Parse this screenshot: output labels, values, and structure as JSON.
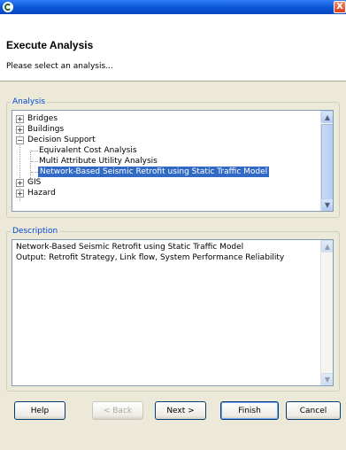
{
  "window": {
    "close_label": "X"
  },
  "header": {
    "title": "Execute Analysis",
    "subtitle": "Please select an analysis..."
  },
  "analysis": {
    "legend": "Analysis",
    "items": {
      "bridges": "Bridges",
      "buildings": "Buildings",
      "decision_support": "Decision Support",
      "equivalent_cost": "Equivalent Cost Analysis",
      "multi_attribute": "Multi Attribute Utility Analysis",
      "network_retrofit": "Network-Based Seismic Retrofit using Static Traffic Model",
      "gis": "GIS",
      "hazard": "Hazard"
    },
    "selected": "network_retrofit"
  },
  "description": {
    "legend": "Description",
    "line1": "Network-Based Seismic Retrofit using Static Traffic Model",
    "line2": "Output: Retrofit Strategy, Link flow, System Performance Reliability"
  },
  "buttons": {
    "help": "Help",
    "back": "< Back",
    "next": "Next >",
    "finish": "Finish",
    "cancel": "Cancel"
  },
  "icons": {
    "app": "app-logo-icon",
    "expand": "plus-box-icon",
    "collapse": "minus-box-icon",
    "scroll_up": "arrow-up-icon",
    "scroll_down": "arrow-down-icon"
  },
  "colors": {
    "title_bar": "#0a54d6",
    "selection": "#316ac5",
    "legend_text": "#0046d5"
  }
}
